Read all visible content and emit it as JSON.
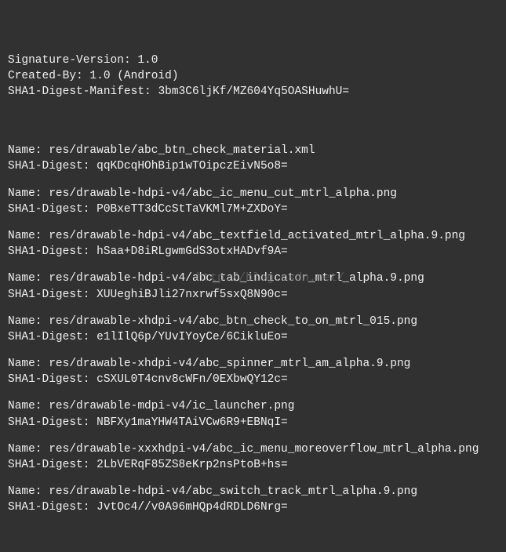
{
  "header": {
    "sig_key": "Signature-Version",
    "sig_val": "1.0",
    "cb_key": "Created-By",
    "cb_val": "1.0 (Android)",
    "sdm_key": "SHA1-Digest-Manifest",
    "sdm_val": "3bm3C6ljKf/MZ604Yq5OASHuwhU="
  },
  "entries": [
    {
      "name": "res/drawable/abc_btn_check_material.xml",
      "digest": "qqKDcqHOhBip1wTOipczEivN5o8="
    },
    {
      "name": "res/drawable-hdpi-v4/abc_ic_menu_cut_mtrl_alpha.png",
      "digest": "P0BxeTT3dCcStTaVKMl7M+ZXDoY="
    },
    {
      "name": "res/drawable-hdpi-v4/abc_textfield_activated_mtrl_alpha.9.png",
      "digest": "hSaa+D8iRLgwmGdS3otxHADvf9A="
    },
    {
      "name": "res/drawable-hdpi-v4/abc_tab_indicator_mtrl_alpha.9.png",
      "digest": "XUUeghiBJli27nxrwf5sxQ8N90c="
    },
    {
      "name": "res/drawable-xhdpi-v4/abc_btn_check_to_on_mtrl_015.png",
      "digest": "e1lIlQ6p/YUvIYoyCe/6CikluEo="
    },
    {
      "name": "res/drawable-xhdpi-v4/abc_spinner_mtrl_am_alpha.9.png",
      "digest": "cSXUL0T4cnv8cWFn/0EXbwQY12c="
    },
    {
      "name": "res/drawable-mdpi-v4/ic_launcher.png",
      "digest": "NBFXy1maYHW4TAiVCw6R9+EBNqI="
    },
    {
      "name": "res/drawable-xxxhdpi-v4/abc_ic_menu_moreoverflow_mtrl_alpha.png",
      "digest": "2LbVERqF85ZS8eKrp2nsPtoB+hs="
    },
    {
      "name": "res/drawable-hdpi-v4/abc_switch_track_mtrl_alpha.9.png",
      "digest": "JvtOc4//v0A96mHQp4dRDLD6Nrg="
    }
  ],
  "labels": {
    "name": "Name",
    "digest": "SHA1-Digest"
  },
  "watermark": "http://blog.csdn.net/"
}
